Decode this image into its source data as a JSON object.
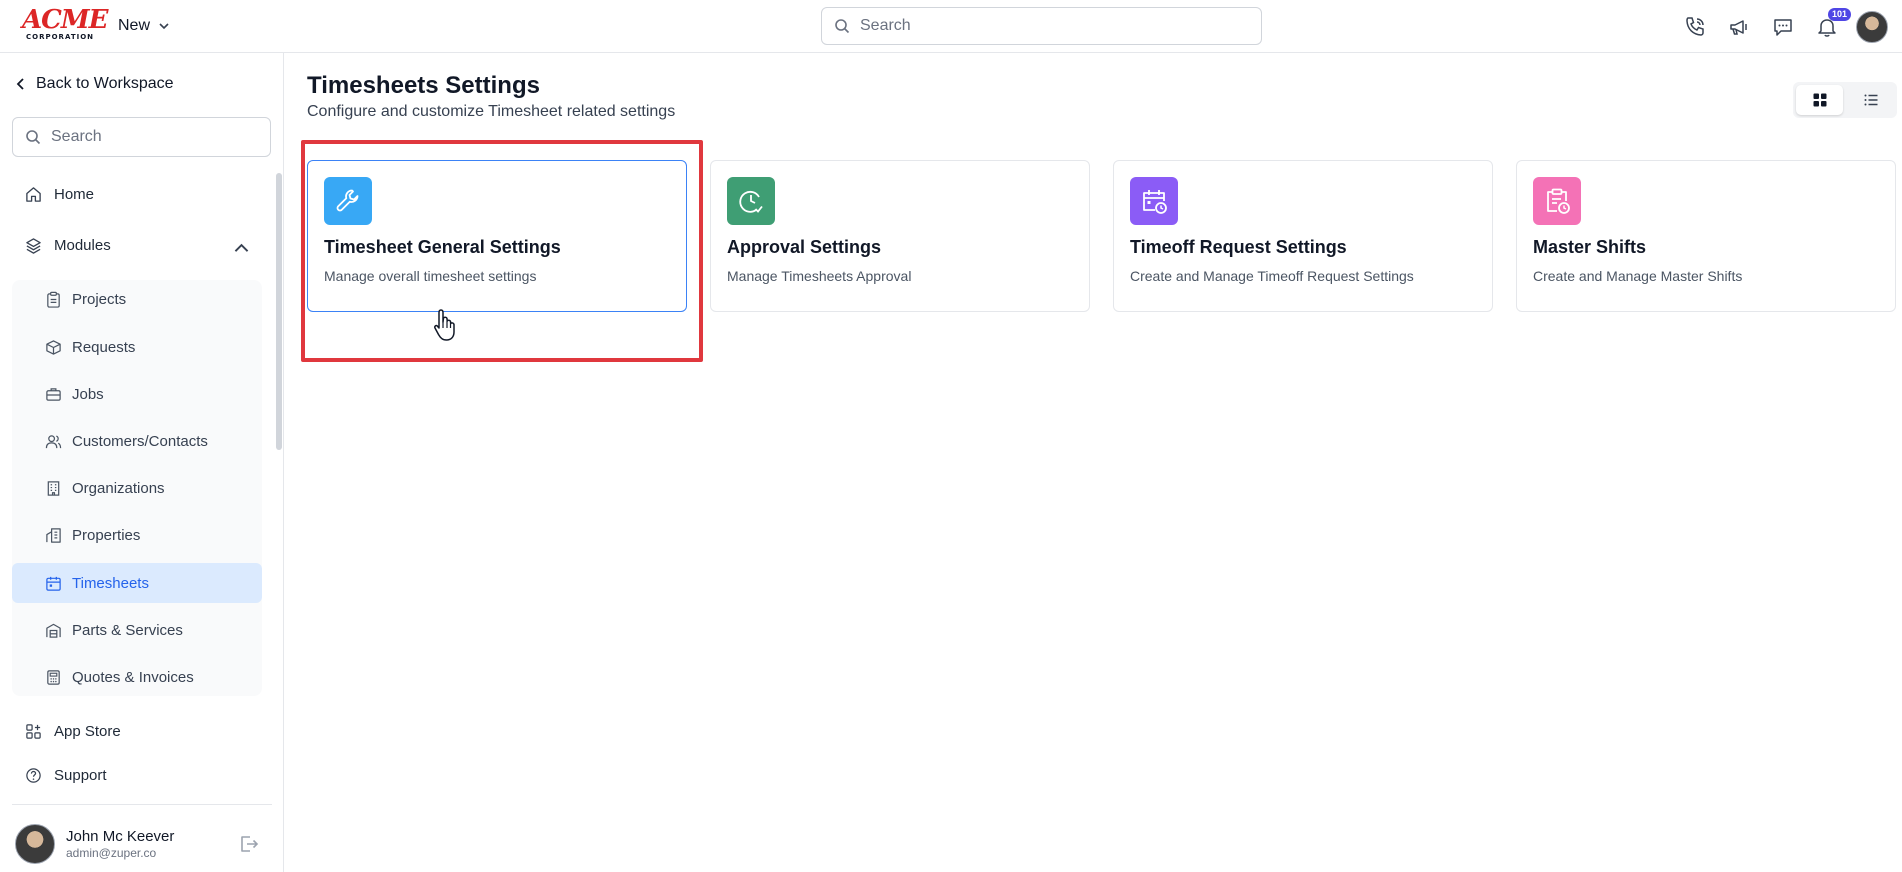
{
  "topbar": {
    "logo_line1": "ACME",
    "logo_line2": "CORPORATION",
    "new_label": "New",
    "search_placeholder": "Search",
    "notification_count": "101",
    "icons": [
      "phone-icon",
      "megaphone-icon",
      "chat-icon",
      "bell-icon"
    ]
  },
  "sidebar": {
    "back_label": "Back to Workspace",
    "search_placeholder": "Search",
    "home_label": "Home",
    "modules_label": "Modules",
    "modules": [
      {
        "label": "Projects",
        "icon": "clipboard-icon"
      },
      {
        "label": "Requests",
        "icon": "box-icon"
      },
      {
        "label": "Jobs",
        "icon": "briefcase-icon"
      },
      {
        "label": "Customers/Contacts",
        "icon": "users-icon"
      },
      {
        "label": "Organizations",
        "icon": "building-icon"
      },
      {
        "label": "Properties",
        "icon": "property-icon"
      },
      {
        "label": "Timesheets",
        "icon": "calendar-icon",
        "active": true
      },
      {
        "label": "Parts & Services",
        "icon": "warehouse-icon"
      },
      {
        "label": "Quotes & Invoices",
        "icon": "calculator-icon"
      }
    ],
    "app_store_label": "App Store",
    "support_label": "Support",
    "user": {
      "name": "John Mc Keever",
      "email": "admin@zuper.co"
    }
  },
  "main": {
    "title": "Timesheets Settings",
    "subtitle": "Configure and customize Timesheet related settings",
    "cards": [
      {
        "title": "Timesheet General Settings",
        "description": "Manage overall timesheet settings",
        "icon": "wrench-icon",
        "color": "#38a8f5"
      },
      {
        "title": "Approval Settings",
        "description": "Manage Timesheets Approval",
        "icon": "clock-check-icon",
        "color": "#3f9e74"
      },
      {
        "title": "Timeoff Request Settings",
        "description": "Create and Manage Timeoff Request Settings",
        "icon": "calendar-clock-icon",
        "color": "#8b5cf6"
      },
      {
        "title": "Master Shifts",
        "description": "Create and Manage Master Shifts",
        "icon": "clipboard-clock-icon",
        "color": "#f472b6"
      }
    ]
  },
  "colors": {
    "active_blue": "#2563eb",
    "highlight_red": "#e0383e",
    "badge": "#4f46e5"
  }
}
